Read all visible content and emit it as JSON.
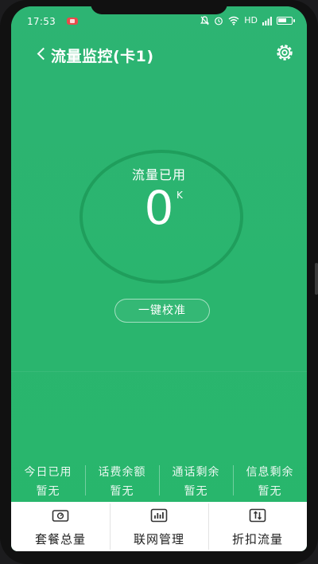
{
  "status_bar": {
    "time": "17:53",
    "network": "HD",
    "icons": [
      "recording-icon",
      "bell-muted-icon",
      "alarm-icon",
      "wifi-icon",
      "signal-icon",
      "battery-icon"
    ]
  },
  "header": {
    "title": "流量监控(卡1)",
    "back_icon": "chevron-left-icon",
    "settings_icon": "gear-icon"
  },
  "usage": {
    "label": "流量已用",
    "value": "0",
    "unit": "K"
  },
  "calibrate_label": "一键校准",
  "stats": [
    {
      "label": "今日已用",
      "value": "暂无"
    },
    {
      "label": "话费余额",
      "value": "暂无"
    },
    {
      "label": "通话剩余",
      "value": "暂无"
    },
    {
      "label": "信息剩余",
      "value": "暂无"
    }
  ],
  "tabs": [
    {
      "label": "套餐总量",
      "icon": "package-icon"
    },
    {
      "label": "联网管理",
      "icon": "bar-chart-icon"
    },
    {
      "label": "折扣流量",
      "icon": "transfer-icon"
    }
  ],
  "colors": {
    "primary_green": "#2bb673",
    "ring": "#1f9e5c",
    "tabbar": "#ffffff"
  }
}
